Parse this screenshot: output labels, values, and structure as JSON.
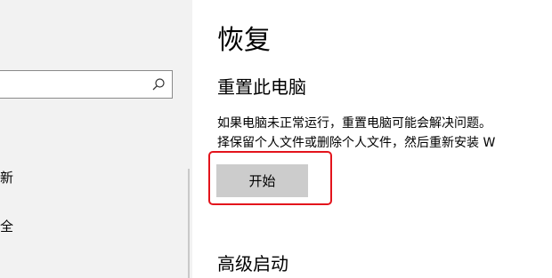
{
  "sidebar": {
    "search": {
      "placeholder": ""
    },
    "items": [
      {
        "label": "新"
      },
      {
        "label": "全"
      }
    ]
  },
  "main": {
    "page_title": "恢复",
    "reset": {
      "title": "重置此电脑",
      "description_lines": [
        "如果电脑未正常运行，重置电脑可能会解决问题。",
        "择保留个人文件或删除个人文件，然后重新安装 W"
      ],
      "start_label": "开始"
    },
    "advanced": {
      "title": "高级启动"
    }
  },
  "colors": {
    "sidebar_bg": "#f2f2f2",
    "button_bg": "#cccccc",
    "highlight_border": "#e3141c"
  },
  "icons": [
    "search-icon"
  ]
}
